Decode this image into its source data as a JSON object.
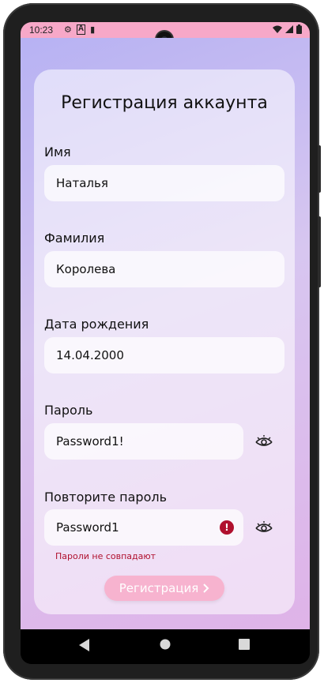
{
  "status_bar": {
    "time": "10:23",
    "left_icons": [
      "gear-icon",
      "a-icon",
      "sim-icon"
    ],
    "right_icons": [
      "wifi-icon",
      "signal-icon",
      "battery-icon"
    ]
  },
  "form": {
    "title": "Регистрация аккаунта",
    "first_name": {
      "label": "Имя",
      "value": "Наталья"
    },
    "last_name": {
      "label": "Фамилия",
      "value": "Королева"
    },
    "birth_date": {
      "label": "Дата рождения",
      "value": "14.04.2000"
    },
    "password": {
      "label": "Пароль",
      "value": "Password1!"
    },
    "repeat_password": {
      "label": "Повторите пароль",
      "value": "Password1",
      "error": "Пароли не совпадают"
    },
    "register_label": "Регистрация"
  },
  "colors": {
    "status_bar": "#f7a8c8",
    "button": "#f7b3cf",
    "error": "#b0102e"
  }
}
